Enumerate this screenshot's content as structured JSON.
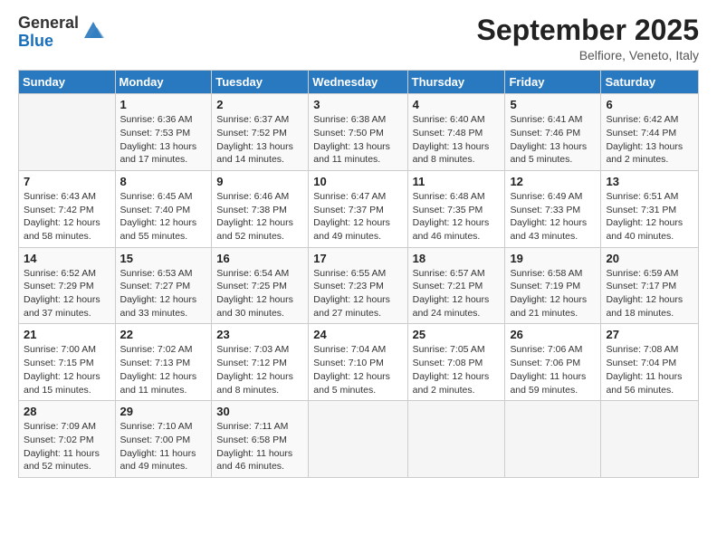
{
  "logo": {
    "general": "General",
    "blue": "Blue"
  },
  "header": {
    "month": "September 2025",
    "location": "Belfiore, Veneto, Italy"
  },
  "weekdays": [
    "Sunday",
    "Monday",
    "Tuesday",
    "Wednesday",
    "Thursday",
    "Friday",
    "Saturday"
  ],
  "weeks": [
    [
      {
        "day": "",
        "detail": ""
      },
      {
        "day": "1",
        "detail": "Sunrise: 6:36 AM\nSunset: 7:53 PM\nDaylight: 13 hours\nand 17 minutes."
      },
      {
        "day": "2",
        "detail": "Sunrise: 6:37 AM\nSunset: 7:52 PM\nDaylight: 13 hours\nand 14 minutes."
      },
      {
        "day": "3",
        "detail": "Sunrise: 6:38 AM\nSunset: 7:50 PM\nDaylight: 13 hours\nand 11 minutes."
      },
      {
        "day": "4",
        "detail": "Sunrise: 6:40 AM\nSunset: 7:48 PM\nDaylight: 13 hours\nand 8 minutes."
      },
      {
        "day": "5",
        "detail": "Sunrise: 6:41 AM\nSunset: 7:46 PM\nDaylight: 13 hours\nand 5 minutes."
      },
      {
        "day": "6",
        "detail": "Sunrise: 6:42 AM\nSunset: 7:44 PM\nDaylight: 13 hours\nand 2 minutes."
      }
    ],
    [
      {
        "day": "7",
        "detail": "Sunrise: 6:43 AM\nSunset: 7:42 PM\nDaylight: 12 hours\nand 58 minutes."
      },
      {
        "day": "8",
        "detail": "Sunrise: 6:45 AM\nSunset: 7:40 PM\nDaylight: 12 hours\nand 55 minutes."
      },
      {
        "day": "9",
        "detail": "Sunrise: 6:46 AM\nSunset: 7:38 PM\nDaylight: 12 hours\nand 52 minutes."
      },
      {
        "day": "10",
        "detail": "Sunrise: 6:47 AM\nSunset: 7:37 PM\nDaylight: 12 hours\nand 49 minutes."
      },
      {
        "day": "11",
        "detail": "Sunrise: 6:48 AM\nSunset: 7:35 PM\nDaylight: 12 hours\nand 46 minutes."
      },
      {
        "day": "12",
        "detail": "Sunrise: 6:49 AM\nSunset: 7:33 PM\nDaylight: 12 hours\nand 43 minutes."
      },
      {
        "day": "13",
        "detail": "Sunrise: 6:51 AM\nSunset: 7:31 PM\nDaylight: 12 hours\nand 40 minutes."
      }
    ],
    [
      {
        "day": "14",
        "detail": "Sunrise: 6:52 AM\nSunset: 7:29 PM\nDaylight: 12 hours\nand 37 minutes."
      },
      {
        "day": "15",
        "detail": "Sunrise: 6:53 AM\nSunset: 7:27 PM\nDaylight: 12 hours\nand 33 minutes."
      },
      {
        "day": "16",
        "detail": "Sunrise: 6:54 AM\nSunset: 7:25 PM\nDaylight: 12 hours\nand 30 minutes."
      },
      {
        "day": "17",
        "detail": "Sunrise: 6:55 AM\nSunset: 7:23 PM\nDaylight: 12 hours\nand 27 minutes."
      },
      {
        "day": "18",
        "detail": "Sunrise: 6:57 AM\nSunset: 7:21 PM\nDaylight: 12 hours\nand 24 minutes."
      },
      {
        "day": "19",
        "detail": "Sunrise: 6:58 AM\nSunset: 7:19 PM\nDaylight: 12 hours\nand 21 minutes."
      },
      {
        "day": "20",
        "detail": "Sunrise: 6:59 AM\nSunset: 7:17 PM\nDaylight: 12 hours\nand 18 minutes."
      }
    ],
    [
      {
        "day": "21",
        "detail": "Sunrise: 7:00 AM\nSunset: 7:15 PM\nDaylight: 12 hours\nand 15 minutes."
      },
      {
        "day": "22",
        "detail": "Sunrise: 7:02 AM\nSunset: 7:13 PM\nDaylight: 12 hours\nand 11 minutes."
      },
      {
        "day": "23",
        "detail": "Sunrise: 7:03 AM\nSunset: 7:12 PM\nDaylight: 12 hours\nand 8 minutes."
      },
      {
        "day": "24",
        "detail": "Sunrise: 7:04 AM\nSunset: 7:10 PM\nDaylight: 12 hours\nand 5 minutes."
      },
      {
        "day": "25",
        "detail": "Sunrise: 7:05 AM\nSunset: 7:08 PM\nDaylight: 12 hours\nand 2 minutes."
      },
      {
        "day": "26",
        "detail": "Sunrise: 7:06 AM\nSunset: 7:06 PM\nDaylight: 11 hours\nand 59 minutes."
      },
      {
        "day": "27",
        "detail": "Sunrise: 7:08 AM\nSunset: 7:04 PM\nDaylight: 11 hours\nand 56 minutes."
      }
    ],
    [
      {
        "day": "28",
        "detail": "Sunrise: 7:09 AM\nSunset: 7:02 PM\nDaylight: 11 hours\nand 52 minutes."
      },
      {
        "day": "29",
        "detail": "Sunrise: 7:10 AM\nSunset: 7:00 PM\nDaylight: 11 hours\nand 49 minutes."
      },
      {
        "day": "30",
        "detail": "Sunrise: 7:11 AM\nSunset: 6:58 PM\nDaylight: 11 hours\nand 46 minutes."
      },
      {
        "day": "",
        "detail": ""
      },
      {
        "day": "",
        "detail": ""
      },
      {
        "day": "",
        "detail": ""
      },
      {
        "day": "",
        "detail": ""
      }
    ]
  ]
}
